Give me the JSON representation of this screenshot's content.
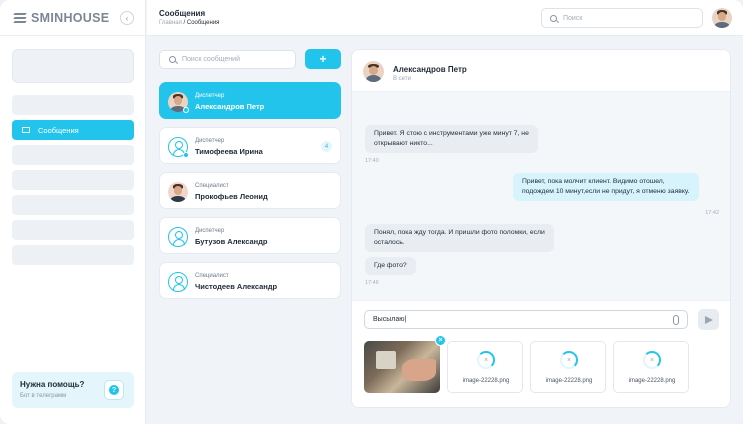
{
  "app": {
    "brand": "SMINHOUSE",
    "collapse_icon": "‹"
  },
  "header": {
    "title": "Сообщения",
    "crumb_home": "Главная",
    "crumb_sep": "/",
    "crumb_current": "Сообщения",
    "search_placeholder": "Поиск"
  },
  "sidebar": {
    "items": [
      {
        "label": ""
      },
      {
        "label": "Сообщения",
        "active": true
      },
      {
        "label": ""
      },
      {
        "label": ""
      },
      {
        "label": ""
      },
      {
        "label": ""
      },
      {
        "label": ""
      }
    ],
    "help_title": "Нужна помощь?",
    "help_sub": "Бот в телеграмм",
    "help_icon": "?"
  },
  "conversations": {
    "search_placeholder": "Поиск сообщений",
    "add_label": "+",
    "items": [
      {
        "role": "Диспетчер",
        "name": "Александров Петр",
        "active": true
      },
      {
        "role": "Диспетчер",
        "name": "Тимофеева Ирина",
        "count": "4"
      },
      {
        "role": "Специалист",
        "name": "Прокофьев Леонид"
      },
      {
        "role": "Диспетчер",
        "name": "Бутузов Александр"
      },
      {
        "role": "Специалист",
        "name": "Чистодеев Александр"
      }
    ]
  },
  "chat": {
    "name": "Александров Петр",
    "status": "В сети",
    "messages": [
      {
        "dir": "in",
        "text_1": "Привет. Я стою с инструментами уже минут 7, не",
        "text_2": "открывают никто...",
        "time": "17:40"
      },
      {
        "dir": "out",
        "text_1": "Привет, пока молчит клиент. Видимо отошел,",
        "text_2": "подождем 10 минут,если не придут, я отменю заявку.",
        "time": "17:42"
      },
      {
        "dir": "in",
        "text_1": "Понял, пока жду тогда. И пришли фото поломки, если",
        "text_2": "осталось."
      },
      {
        "dir": "in",
        "text_1": "Где фото?",
        "time": "17:46"
      }
    ],
    "input_value": "Высылаю|",
    "attachments": [
      {
        "kind": "photo"
      },
      {
        "name": "image-22228.png"
      },
      {
        "name": "image-22228.png"
      },
      {
        "name": "image-22228.png"
      }
    ],
    "close_glyph": "×",
    "spinner_glyph": "×"
  },
  "colors": {
    "accent": "#22c4ec",
    "bubble_out": "#d7f3fb",
    "bubble_in": "#e9edf2"
  }
}
